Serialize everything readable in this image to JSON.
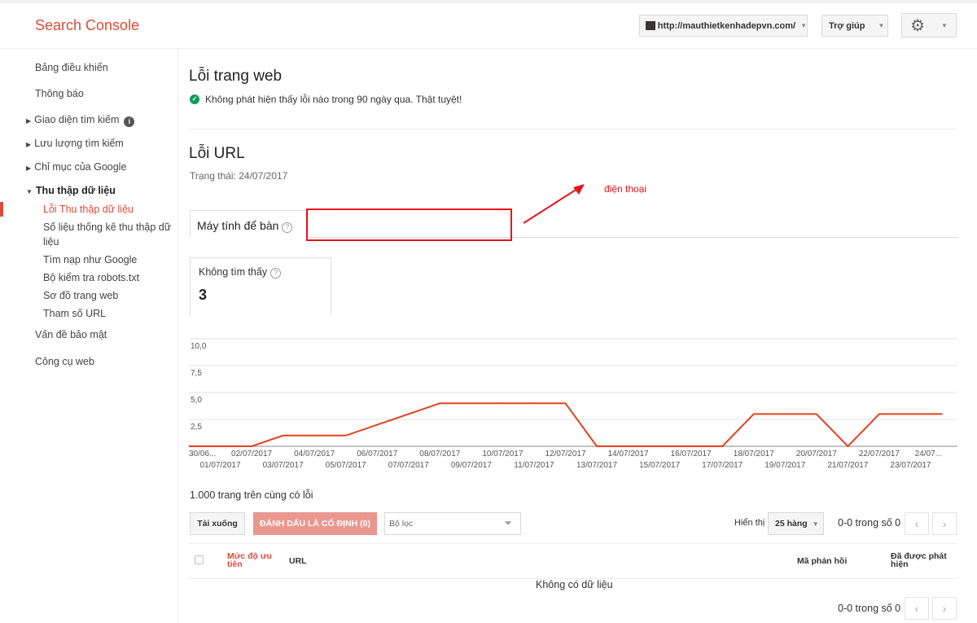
{
  "header": {
    "logo": "Search Console",
    "site": "http://mauthietkenhadepvn.com/",
    "help": "Trợ giúp"
  },
  "sidebar": {
    "items": [
      {
        "label": "Bảng điều khiển"
      },
      {
        "label": "Thông báo"
      },
      {
        "label": "Giao diện tìm kiếm"
      },
      {
        "label": "Lưu lượng tìm kiếm"
      },
      {
        "label": "Chỉ mục của Google"
      },
      {
        "label": "Thu thập dữ liệu"
      },
      {
        "label": "Vấn đề bảo mật"
      },
      {
        "label": "Công cụ web"
      }
    ],
    "subitems": [
      {
        "label": "Lỗi Thu thập dữ liệu"
      },
      {
        "label": "Số liệu thống kê thu thập dữ liệu"
      },
      {
        "label": "Tìm nạp như Google"
      },
      {
        "label": "Bộ kiểm tra robots.txt"
      },
      {
        "label": "Sơ đồ trang web"
      },
      {
        "label": "Tham số URL"
      }
    ]
  },
  "site_errors": {
    "title": "Lỗi trang web",
    "message": "Không phát hiện thấy lỗi nào trong 90 ngày qua. Thật tuyệt!"
  },
  "url_errors": {
    "title": "Lỗi URL",
    "status": "Trạng thái: 24/07/2017",
    "tab": "Máy tính để bàn",
    "annotation": "điện thoại",
    "card_label": "Không tìm thấy",
    "card_value": "3"
  },
  "chart_data": {
    "type": "line",
    "y_ticks": [
      "10,0",
      "7,5",
      "5,0",
      "2,5"
    ],
    "ylim": [
      0,
      10
    ],
    "x_labels_top": [
      "30/06...",
      "02/07/2017",
      "04/07/2017",
      "06/07/2017",
      "08/07/2017",
      "10/07/2017",
      "12/07/2017",
      "14/07/2017",
      "16/07/2017",
      "18/07/2017",
      "20/07/2017",
      "22/07/2017",
      "24/07..."
    ],
    "x_labels_bottom": [
      "01/07/2017",
      "03/07/2017",
      "05/07/2017",
      "07/07/2017",
      "09/07/2017",
      "11/07/2017",
      "13/07/2017",
      "15/07/2017",
      "17/07/2017",
      "19/07/2017",
      "21/07/2017",
      "23/07/2017"
    ],
    "series": [
      {
        "values": [
          0,
          0,
          0,
          1,
          1,
          1,
          2,
          3,
          4,
          4,
          4,
          4,
          4,
          0,
          0,
          0,
          0,
          0,
          3,
          3,
          3,
          0,
          3,
          3,
          3
        ],
        "color": "#e0431f"
      }
    ]
  },
  "table": {
    "summary": "1.000 trang trên cùng có lỗi",
    "download": "Tải xuống",
    "mark_fixed": "ĐÁNH DẤU LÀ CỐ ĐỊNH (0)",
    "filter_placeholder": "Bộ lọc",
    "show_label": "Hiển thị",
    "rows": "25 hàng",
    "pager": "0-0 trong số 0",
    "col_priority": "Mức độ ưu tiên",
    "col_url": "URL",
    "col_response": "Mã phản hồi",
    "col_detected": "Đã được phát hiện",
    "no_data": "Không có dữ liệu"
  }
}
